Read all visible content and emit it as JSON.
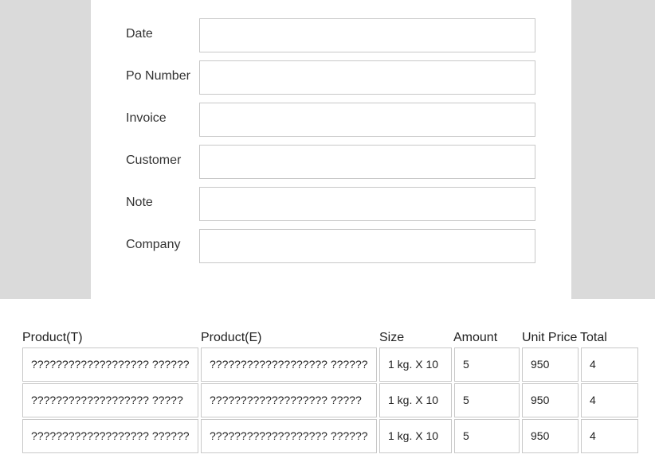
{
  "form": {
    "fields": [
      {
        "label": "Date",
        "value": ""
      },
      {
        "label": "Po Number",
        "value": ""
      },
      {
        "label": "Invoice",
        "value": ""
      },
      {
        "label": "Customer",
        "value": ""
      },
      {
        "label": "Note",
        "value": ""
      },
      {
        "label": "Company",
        "value": ""
      }
    ]
  },
  "table": {
    "headers": [
      "Product(T)",
      "Product(E)",
      "Size",
      "Amount",
      "Unit Price",
      "Total"
    ],
    "rows": [
      [
        "??????????????????? ??????",
        "??????????????????? ??????",
        "1 kg. X 10",
        "5",
        "950",
        "4"
      ],
      [
        "??????????????????? ?????",
        "??????????????????? ?????",
        "1 kg. X 10",
        "5",
        "950",
        "4"
      ],
      [
        "??????????????????? ??????",
        "??????????????????? ??????",
        "1 kg. X 10",
        "5",
        "950",
        "4"
      ]
    ]
  },
  "colors": {
    "side_background": "#dadada",
    "border": "#c8c8c8"
  }
}
